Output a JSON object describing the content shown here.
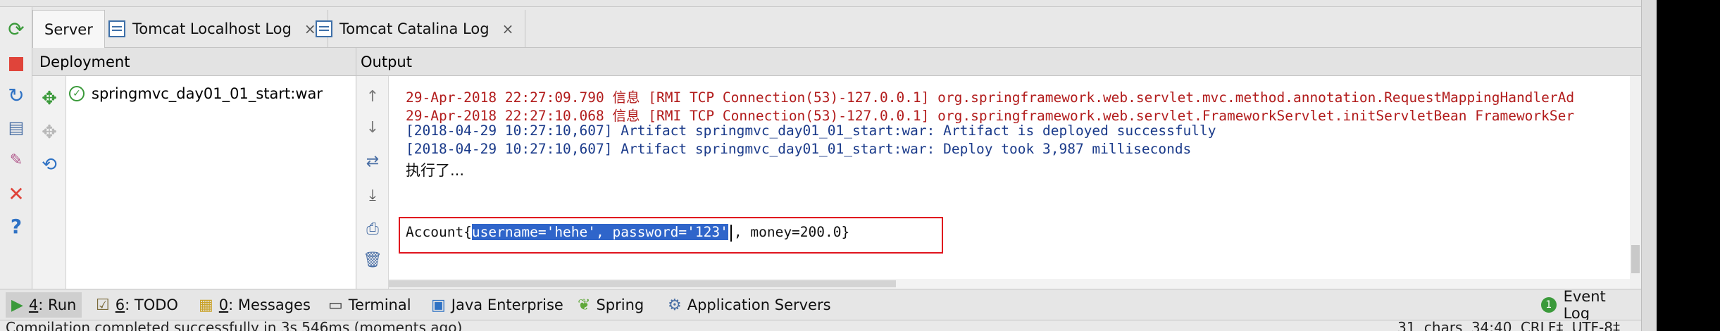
{
  "tabs": [
    {
      "label": "Server",
      "closable": false
    },
    {
      "label": "Tomcat Localhost Log",
      "closable": true
    },
    {
      "label": "Tomcat Catalina Log",
      "closable": true
    }
  ],
  "close_glyph": "×",
  "deployment": {
    "header": "Deployment",
    "artifact": "springmvc_day01_01_start:war"
  },
  "output": {
    "header": "Output",
    "lines": [
      "29-Apr-2018 22:27:09.790 信息 [RMI TCP Connection(53)-127.0.0.1] org.springframework.web.servlet.mvc.method.annotation.RequestMappingHandlerAd",
      "29-Apr-2018 22:27:10.068 信息 [RMI TCP Connection(53)-127.0.0.1] org.springframework.web.servlet.FrameworkServlet.initServletBean FrameworkSer",
      "[2018-04-29 10:27:10,607] Artifact springmvc_day01_01_start:war: Artifact is deployed successfully",
      "[2018-04-29 10:27:10,607] Artifact springmvc_day01_01_start:war: Deploy took 3,987 milliseconds",
      "执行了..."
    ],
    "account_prefix": "Account{",
    "account_selected": "username='hehe', password='123'",
    "account_suffix": ", money=200.0}"
  },
  "bottom_tabs": [
    {
      "number": "4",
      "label": ": Run",
      "icon": "run-icon"
    },
    {
      "number": "6",
      "label": ": TODO",
      "icon": "todo-icon"
    },
    {
      "number": "0",
      "label": ": Messages",
      "icon": "messages-icon"
    },
    {
      "number": "",
      "label": "Terminal",
      "icon": "terminal-icon"
    },
    {
      "number": "",
      "label": "Java Enterprise",
      "icon": "java-enterprise-icon"
    },
    {
      "number": "",
      "label": "Spring",
      "icon": "spring-icon"
    },
    {
      "number": "",
      "label": "Application Servers",
      "icon": "application-servers-icon"
    }
  ],
  "event_log": {
    "label": "Event Log",
    "count": "1"
  },
  "status": {
    "message": "Compilation completed successfully in 3s 546ms (moments ago)",
    "right": "31 chars   34:40   CRLF‡   UTF-8‡"
  },
  "colors": {
    "accent": "#2f65ca",
    "highlight_box": "#e0141e",
    "log_info": "#b21c1c",
    "success": "#3b9a3b"
  }
}
